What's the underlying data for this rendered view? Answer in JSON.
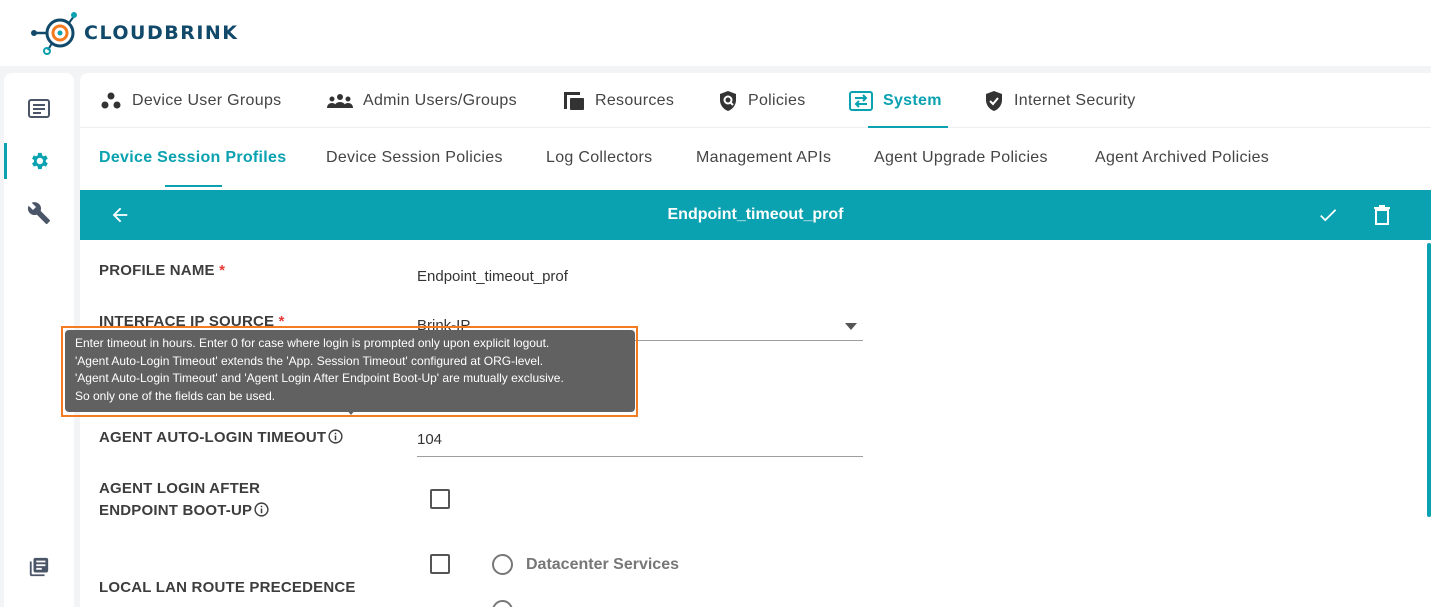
{
  "app": {
    "brand": "CLOUDBRINK",
    "accent_color": "#0aa1b0",
    "brand_color": "#11496a"
  },
  "rail": {
    "items": [
      {
        "icon": "list-icon",
        "active": false
      },
      {
        "icon": "gear-icon",
        "active": true
      },
      {
        "icon": "wrench-icon",
        "active": false
      },
      {
        "icon": "document-list-icon",
        "active": false
      }
    ]
  },
  "nav": {
    "tabs": [
      {
        "label": "Device User Groups",
        "icon": "user-groups-icon"
      },
      {
        "label": "Admin Users/Groups",
        "icon": "admin-users-icon"
      },
      {
        "label": "Resources",
        "icon": "resources-icon"
      },
      {
        "label": "Policies",
        "icon": "policy-shield-icon"
      },
      {
        "label": "System",
        "icon": "system-icon",
        "active": true
      },
      {
        "label": "Internet Security",
        "icon": "security-shield-icon"
      }
    ]
  },
  "subnav": {
    "tabs": [
      {
        "label": "Device Session Profiles",
        "active": true
      },
      {
        "label": "Device Session Policies"
      },
      {
        "label": "Log Collectors"
      },
      {
        "label": "Management APIs"
      },
      {
        "label": "Agent Upgrade Policies"
      },
      {
        "label": "Agent Archived Policies"
      }
    ]
  },
  "profile": {
    "title": "Endpoint_timeout_prof",
    "back_icon": "arrow-left-icon",
    "save_icon": "check-icon",
    "delete_icon": "trash-icon"
  },
  "form": {
    "profile_name": {
      "label": "PROFILE NAME",
      "required": "*",
      "value": "Endpoint_timeout_prof"
    },
    "interface_ip_source": {
      "label": "INTERFACE IP SOURCE",
      "required": "*",
      "value": "Brink-IP"
    },
    "agent_auto_login_timeout": {
      "label": "AGENT AUTO-LOGIN TIMEOUT",
      "value": "104"
    },
    "agent_login_after_boot": {
      "label_line1": "AGENT LOGIN AFTER",
      "label_line2": "ENDPOINT BOOT-UP",
      "checked": false
    },
    "local_lan_route_precedence": {
      "label": "LOCAL LAN ROUTE PRECEDENCE",
      "checked": false,
      "options": [
        "Datacenter Services"
      ]
    }
  },
  "tooltip": {
    "lines": [
      "Enter timeout in hours. Enter 0 for case where login is prompted only upon explicit logout.",
      "'Agent Auto-Login Timeout' extends the 'App. Session Timeout' configured at ORG-level.",
      "'Agent Auto-Login Timeout' and 'Agent Login After Endpoint Boot-Up' are mutually exclusive.",
      "So only one of the fields can be used."
    ]
  }
}
